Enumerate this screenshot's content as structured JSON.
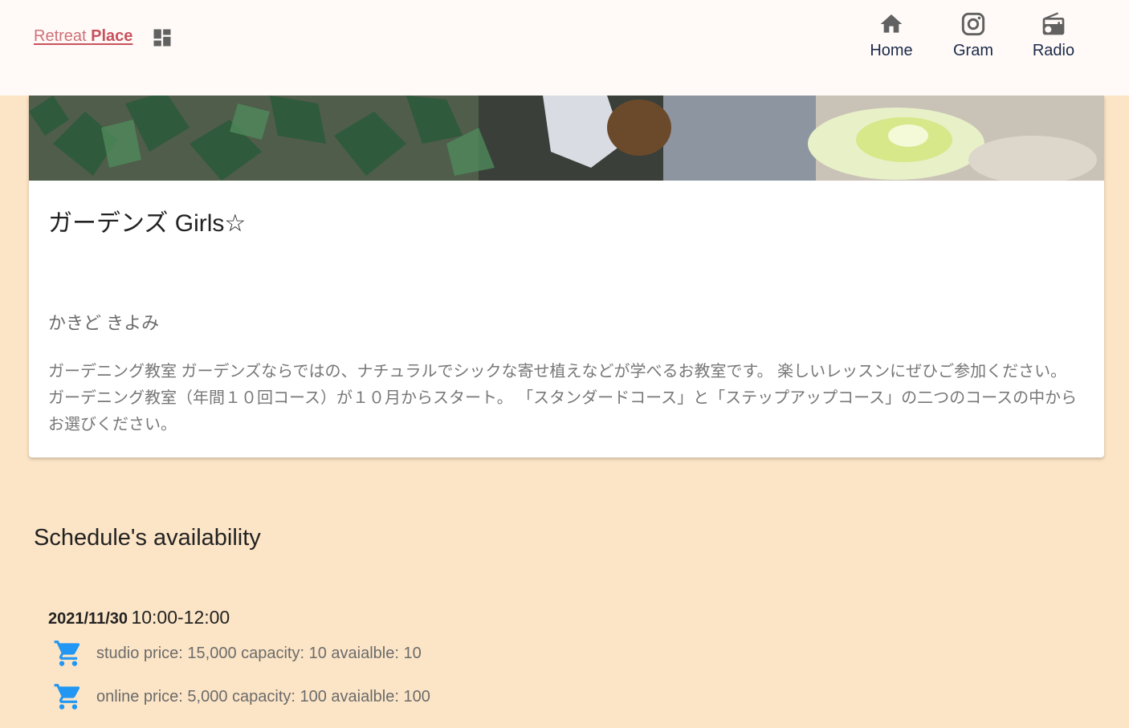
{
  "header": {
    "brand_light": "Retreat",
    "brand_bold": "Place",
    "nav": [
      {
        "label": "Home",
        "icon": "home-icon"
      },
      {
        "label": "Gram",
        "icon": "instagram-icon"
      },
      {
        "label": "Radio",
        "icon": "radio-icon"
      }
    ],
    "dashboard_icon": "dashboard-icon"
  },
  "card": {
    "title": "ガーデンズ Girls☆",
    "subtitle": "かきど きよみ",
    "description": "ガーデニング教室 ガーデンズならではの、ナチュラルでシックな寄せ植えなどが学べるお教室です。 楽しいレッスンにぜひご参加ください。 ガーデニング教室（年間１０回コース）が１０月からスタート。 「スタンダードコース」と「ステップアップコース」の二つのコースの中からお選びください。"
  },
  "schedule": {
    "heading": "Schedule's availability",
    "slots": [
      {
        "date": "2021/11/30",
        "time": "10:00-12:00",
        "options": [
          {
            "text": "studio price: 15,000 capacity: 10 avaialble: 10",
            "icon": "cart-icon"
          },
          {
            "text": "online price: 5,000 capacity: 100 avaialble: 100",
            "icon": "cart-icon"
          }
        ]
      }
    ]
  },
  "colors": {
    "background": "#fce5c6",
    "header_bg": "#fffaf7",
    "brand": "#c9515d",
    "cart_icon": "#2196f3",
    "nav_icon": "#616161"
  }
}
